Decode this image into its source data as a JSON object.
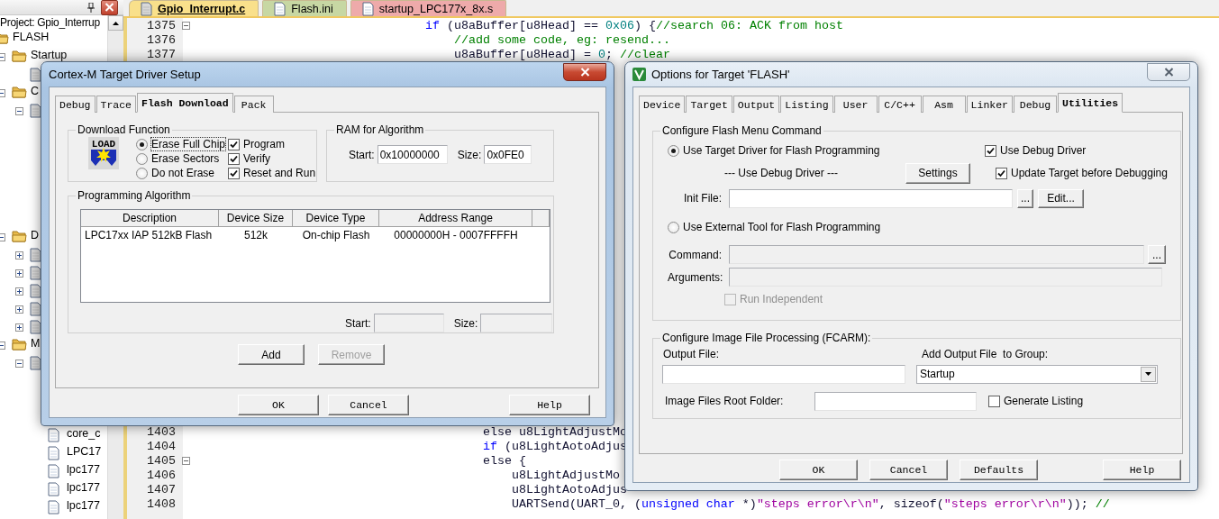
{
  "project_panel": {
    "title": "Project: Gpio_Interrup",
    "tree": [
      {
        "label": "FLASH",
        "kind": "folder",
        "children": [
          {
            "label": "Startup",
            "kind": "folder",
            "expanded": true,
            "children": [
              {
                "kind": "file"
              }
            ]
          },
          {
            "label": "C",
            "kind": "folder",
            "expanded": true,
            "children": [
              {
                "kind": "file",
                "expanded": true
              }
            ]
          },
          {
            "label": "D",
            "kind": "folder",
            "expanded": true,
            "children": [
              {
                "kind": "file",
                "expanded": false
              },
              {
                "kind": "file",
                "expanded": false
              },
              {
                "kind": "file",
                "expanded": false
              },
              {
                "kind": "file",
                "expanded": false
              },
              {
                "kind": "file",
                "expanded": false
              }
            ]
          },
          {
            "label": "M",
            "kind": "folder",
            "expanded": true,
            "children": [
              {
                "kind": "file",
                "expanded": true,
                "children": [
                  {
                    "label": "core_c",
                    "kind": "document"
                  },
                  {
                    "label": "LPC17",
                    "kind": "document"
                  },
                  {
                    "label": "lpc177",
                    "kind": "document"
                  },
                  {
                    "label": "lpc177",
                    "kind": "document"
                  },
                  {
                    "label": "lpc177",
                    "kind": "document"
                  }
                ]
              }
            ]
          }
        ]
      }
    ]
  },
  "editor": {
    "tabs": [
      {
        "label": "Gpio_Interrupt.c",
        "color": "#f9e08b",
        "selected": true
      },
      {
        "label": "Flash.ini",
        "color": "#c7d7a3",
        "selected": false
      },
      {
        "label": "startup_LPC177x_8x.s",
        "color": "#eeaaaa",
        "selected": false
      }
    ],
    "lines_top": [
      {
        "number": "1375",
        "fold": true,
        "tokens": [
          {
            "kind": "keyword",
            "text": "                                if"
          },
          {
            "kind": "plain",
            "text": " (u8aBuffer[u8Head] == "
          },
          {
            "kind": "number",
            "text": "0x06"
          },
          {
            "kind": "plain",
            "text": ") {"
          },
          {
            "kind": "comment",
            "text": "//search 06: ACK from host"
          }
        ]
      },
      {
        "number": "1376",
        "fold": false,
        "tokens": [
          {
            "kind": "comment",
            "text": "                                    //add some code, eg: resend..."
          }
        ]
      },
      {
        "number": "1377",
        "fold": false,
        "tokens": [
          {
            "kind": "plain",
            "text": "                                    u8aBuffer[u8Head] = "
          },
          {
            "kind": "number",
            "text": "0"
          },
          {
            "kind": "plain",
            "text": "; "
          },
          {
            "kind": "comment",
            "text": "//clear"
          }
        ]
      }
    ],
    "lines_bottom": [
      {
        "number": "1403",
        "fold": false,
        "tokens": [
          {
            "kind": "plain",
            "text": "                                        else u8LightAdjustMo"
          }
        ]
      },
      {
        "number": "1404",
        "fold": false,
        "tokens": [
          {
            "kind": "keyword",
            "text": "                                        if"
          },
          {
            "kind": "plain",
            "text": " (u8LightAotoAdjus"
          }
        ]
      },
      {
        "number": "1405",
        "fold": true,
        "tokens": [
          {
            "kind": "plain",
            "text": "                                        else {"
          }
        ]
      },
      {
        "number": "1406",
        "fold": false,
        "tokens": [
          {
            "kind": "plain",
            "text": "                                            u8LightAdjustMo"
          }
        ]
      },
      {
        "number": "1407",
        "fold": false,
        "tokens": [
          {
            "kind": "plain",
            "text": "                                            u8LightAotoAdjus"
          }
        ]
      },
      {
        "number": "1408",
        "fold": false,
        "tokens": [
          {
            "kind": "plain",
            "text": "                                            UARTSend(UART_0, ("
          },
          {
            "kind": "keyword",
            "text": "unsigned char"
          },
          {
            "kind": "plain",
            "text": " *)"
          },
          {
            "kind": "string",
            "text": "\"steps error\\r\\n\""
          },
          {
            "kind": "plain",
            "text": ", sizeof("
          },
          {
            "kind": "string",
            "text": "\"steps error\\r\\n\""
          },
          {
            "kind": "plain",
            "text": ")); "
          },
          {
            "kind": "comment",
            "text": "//"
          }
        ]
      }
    ]
  },
  "driver_setup": {
    "title": "Cortex-M Target Driver Setup",
    "active": true,
    "tabs": [
      {
        "label": "Debug",
        "selected": false
      },
      {
        "label": "Trace",
        "selected": false
      },
      {
        "label": "Flash Download",
        "selected": true
      },
      {
        "label": "Pack",
        "selected": false
      }
    ],
    "download_function": {
      "title": "Download Function",
      "icon_text": "LOAD",
      "erase_options": [
        {
          "label": "Erase Full Chip",
          "selected": true
        },
        {
          "label": "Erase Sectors",
          "selected": false
        },
        {
          "label": "Do not Erase",
          "selected": false
        }
      ],
      "actions": [
        {
          "label": "Program",
          "checked": true
        },
        {
          "label": "Verify",
          "checked": true
        },
        {
          "label": "Reset and Run",
          "checked": true
        }
      ]
    },
    "ram": {
      "title": "RAM for Algorithm",
      "start_label": "Start:",
      "start": "0x10000000",
      "size_label": "Size:",
      "size": "0x0FE0"
    },
    "algorithm": {
      "title": "Programming Algorithm",
      "columns": [
        "Description",
        "Device Size",
        "Device Type",
        "Address Range"
      ],
      "rows": [
        [
          "LPC17xx IAP 512kB Flash",
          "512k",
          "On-chip Flash",
          "00000000H - 0007FFFFH"
        ]
      ],
      "start_label": "Start:",
      "size_label": "Size:"
    },
    "buttons": [
      {
        "label": "Add",
        "disabled": false
      },
      {
        "label": "Remove",
        "disabled": true
      }
    ],
    "footer_buttons": [
      "OK",
      "Cancel",
      "Help"
    ]
  },
  "options": {
    "title": "Options for Target 'FLASH'",
    "active": false,
    "tabs": [
      {
        "label": "Device",
        "selected": false
      },
      {
        "label": "Target",
        "selected": false
      },
      {
        "label": "Output",
        "selected": false
      },
      {
        "label": "Listing",
        "selected": false
      },
      {
        "label": "User",
        "selected": false
      },
      {
        "label": "C/C++",
        "selected": false
      },
      {
        "label": "Asm",
        "selected": false
      },
      {
        "label": "Linker",
        "selected": false
      },
      {
        "label": "Debug",
        "selected": false
      },
      {
        "label": "Utilities",
        "selected": true
      }
    ],
    "flash_menu": {
      "title": "Configure Flash Menu Command",
      "modes": [
        {
          "label": "Use Target Driver for Flash Programming",
          "selected": true
        },
        {
          "label": "Use External Tool for Flash Programming",
          "selected": false
        }
      ],
      "driver": "--- Use Debug Driver ---",
      "settings_button": "Settings",
      "driver_options": [
        {
          "label": "Use Debug Driver",
          "checked": true
        },
        {
          "label": "Update Target before Debugging",
          "checked": true
        }
      ],
      "init_file": {
        "label": "Init File:",
        "browse": "...",
        "edit": "Edit..."
      },
      "command": {
        "label": "Command:",
        "browse": "...",
        "disabled": true
      },
      "arguments": {
        "label": "Arguments:",
        "disabled": true
      },
      "run_independent": {
        "label": "Run Independent",
        "checked": false,
        "disabled": true
      }
    },
    "image_processing": {
      "title": "Configure Image File Processing (FCARM):",
      "output_label": "Output File:",
      "group_label": "Add Output File  to Group:",
      "group_value": "Startup",
      "root_label": "Image Files Root Folder:",
      "generate_listing": {
        "label": "Generate Listing",
        "checked": false
      }
    },
    "footer_buttons": [
      "OK",
      "Cancel",
      "Defaults",
      "Help"
    ]
  }
}
